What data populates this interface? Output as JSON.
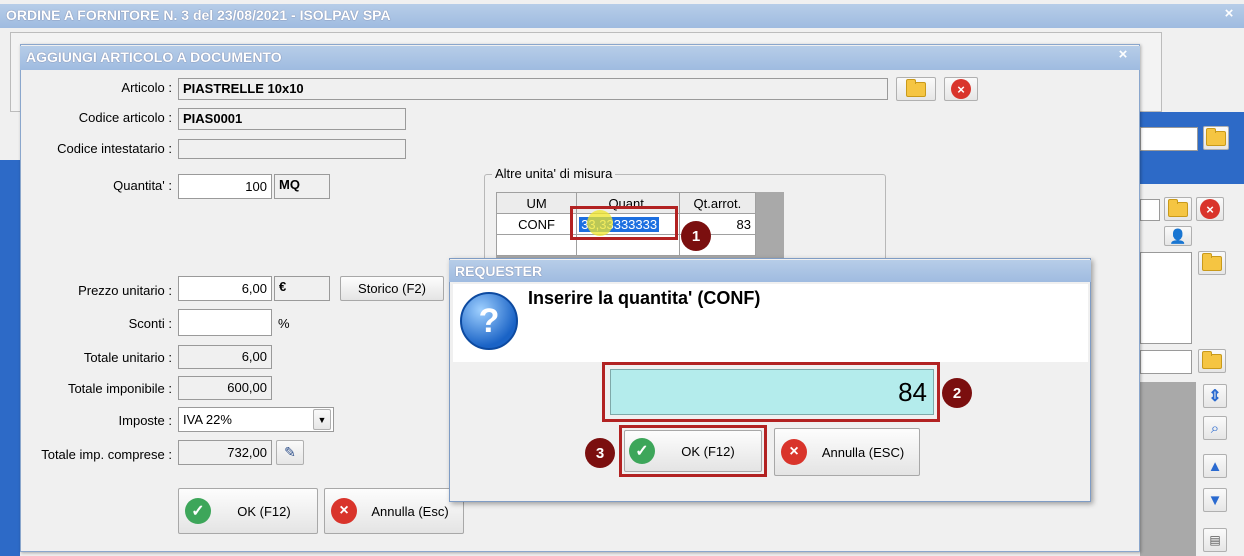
{
  "main_window": {
    "title": "ORDINE A FORNITORE N. 3 del 23/08/2021 - ISOLPAV SPA",
    "close": "×"
  },
  "dialog": {
    "title": "AGGIUNGI ARTICOLO A DOCUMENTO",
    "close": "×",
    "articolo_label": "Articolo :",
    "articolo_value": "PIASTRELLE 10x10",
    "codice_label": "Codice articolo :",
    "codice_value": "PIAS0001",
    "codice_int_label": "Codice intestatario :",
    "codice_int_value": "",
    "quantita_label": "Quantita' :",
    "quantita_value": "100",
    "quantita_um": "MQ",
    "altre_um_legend": "Altre unita' di misura",
    "um_table": {
      "headers": [
        "UM",
        "Quant.",
        "Qt.arrot."
      ],
      "row": {
        "um": "CONF",
        "quant": "33,33333333",
        "qt_arrot": "83"
      }
    },
    "prezzo_label": "Prezzo unitario :",
    "prezzo_value": "6,00",
    "prezzo_currency": "€",
    "storico_button": "Storico (F2)",
    "sconti_label": "Sconti :",
    "sconti_value": "",
    "sconti_unit": "%",
    "tot_unitario_label": "Totale unitario :",
    "tot_unitario_value": "6,00",
    "tot_imponibile_label": "Totale imponibile :",
    "tot_imponibile_value": "600,00",
    "imposte_label": "Imposte :",
    "imposte_value": "IVA 22%",
    "tot_imp_label": "Totale imp. comprese :",
    "tot_imp_value": "732,00",
    "ok_button": "OK (F12)",
    "annulla_button": "Annulla (Esc)"
  },
  "requester": {
    "title": "REQUESTER",
    "message": "Inserire la quantita' (CONF)",
    "input_value": "84",
    "ok_button": "OK (F12)",
    "annulla_button": "Annulla (ESC)"
  },
  "markers": [
    "1",
    "2",
    "3"
  ],
  "colors": {
    "titlebar": "#a7c1e4",
    "input_highlight": "#b4ecec",
    "marker": "#7b0f0f",
    "highlight_box": "#b22222"
  }
}
